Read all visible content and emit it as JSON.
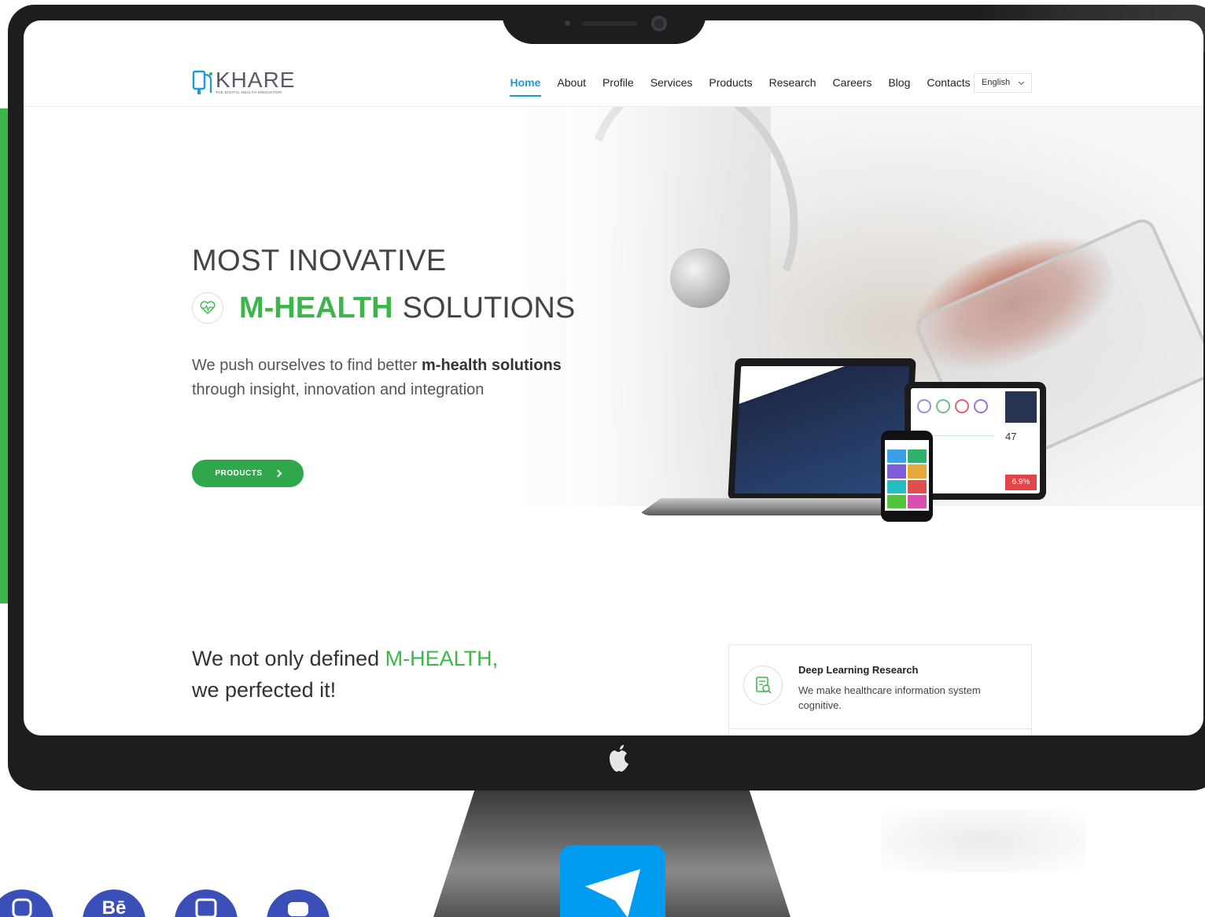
{
  "brand": {
    "name": "KHARE",
    "tagline": "THE DIGITAL HEALTH INNOVATOR!"
  },
  "nav": {
    "items": [
      {
        "label": "Home",
        "active": true
      },
      {
        "label": "About"
      },
      {
        "label": "Profile"
      },
      {
        "label": "Services"
      },
      {
        "label": "Products"
      },
      {
        "label": "Research"
      },
      {
        "label": "Careers"
      },
      {
        "label": "Blog"
      },
      {
        "label": "Contacts"
      }
    ],
    "language": "English"
  },
  "hero": {
    "title_line1": "MOST INOVATIVE",
    "title_accent": "M-HEALTH",
    "title_rest": "SOLUTIONS",
    "subtitle_pre": "We push ourselves to find better ",
    "subtitle_bold": "m-health solutions",
    "subtitle_post": "through insight, innovation and integration",
    "button_label": "PRODUCTS"
  },
  "devices": {
    "tablet_number": "47",
    "tablet_red_value": "6.9%"
  },
  "section": {
    "tagline_pre": "We not only defined ",
    "tagline_accent": "M-HEALTH,",
    "tagline_line2": "we perfected it!"
  },
  "feature_card": {
    "title": "Deep Learning Research",
    "text": "We make healthcare information system cognitive."
  },
  "social": [
    {
      "icon": "instagram-icon"
    },
    {
      "icon": "behance-icon",
      "label": "Bē"
    },
    {
      "icon": "linkedin-icon"
    },
    {
      "icon": "youtube-icon"
    }
  ],
  "colors": {
    "accent_green": "#3cb64a",
    "nav_active": "#1a9ad6",
    "monitor": "#1d1d1f",
    "telegram": "#009cf0",
    "social": "#3a4fb8"
  }
}
